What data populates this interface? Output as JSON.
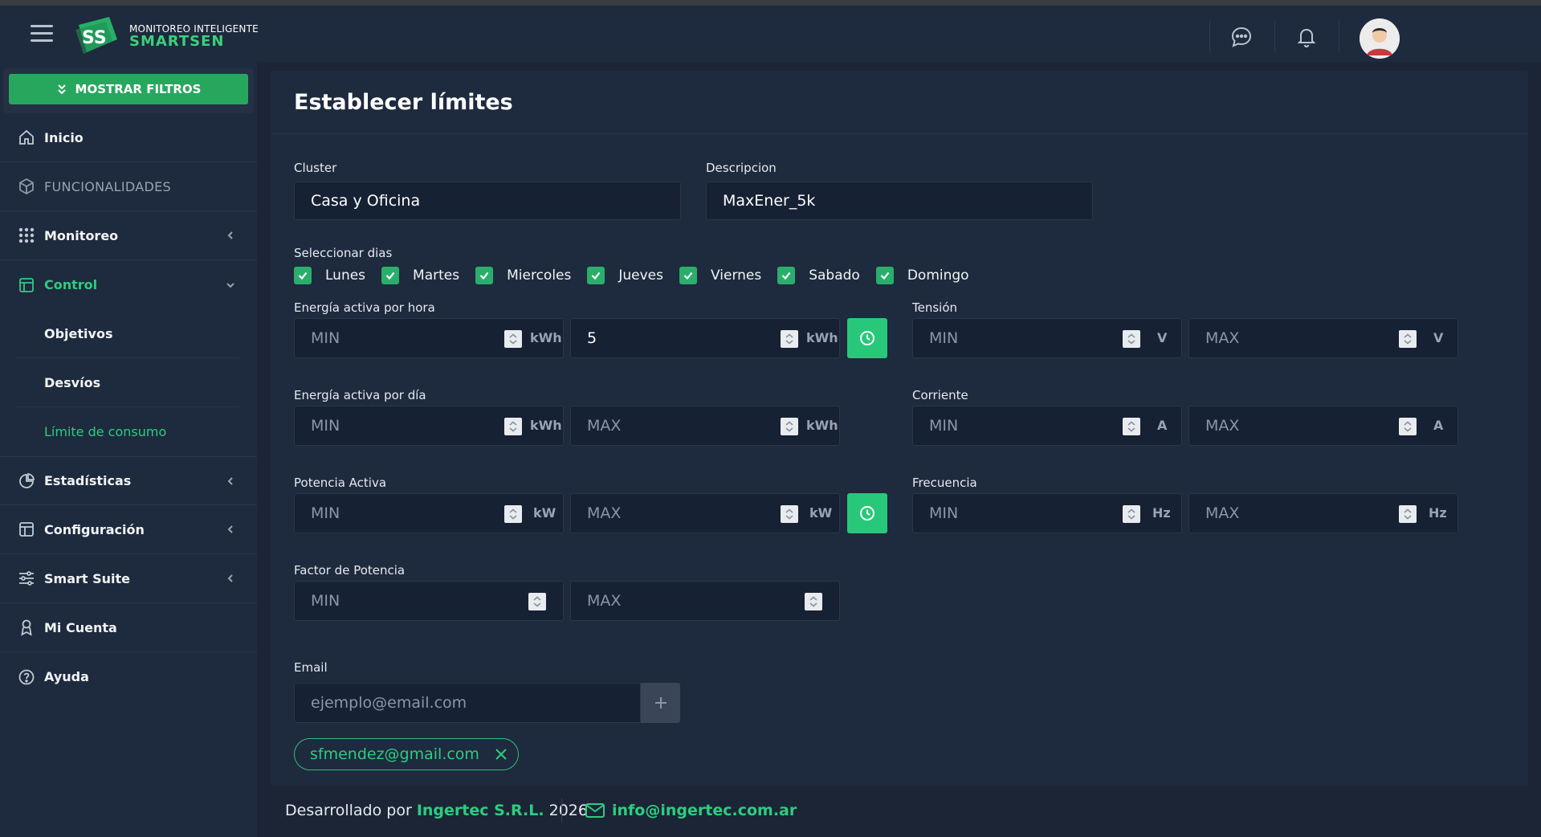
{
  "brand": {
    "subtitle": "MONITOREO INTELIGENTE",
    "name": "SMARTSEN",
    "badge": "SS"
  },
  "sidebar": {
    "filter_button": "MOSTRAR FILTROS",
    "items": [
      {
        "label": "Inicio",
        "icon": "home-icon"
      },
      {
        "label": "FUNCIONALIDADES",
        "icon": "cube-icon"
      },
      {
        "label": "Monitoreo",
        "icon": "grid-icon"
      },
      {
        "label": "Control",
        "icon": "table-icon"
      },
      {
        "label": "Estadísticas",
        "icon": "pie-icon"
      },
      {
        "label": "Configuración",
        "icon": "layout-icon"
      },
      {
        "label": "Smart Suite",
        "icon": "sliders-icon"
      },
      {
        "label": "Mi Cuenta",
        "icon": "user-icon"
      },
      {
        "label": "Ayuda",
        "icon": "help-icon"
      }
    ],
    "control_sub": [
      "Objetivos",
      "Desvíos",
      "Límite de consumo"
    ]
  },
  "panel": {
    "title": "Establecer límites",
    "cluster_label": "Cluster",
    "cluster_value": "Casa y Oficina",
    "descripcion_label": "Descripcion",
    "descripcion_value": "MaxEner_5k",
    "dias_label": "Seleccionar dias",
    "dias": [
      "Lunes",
      "Martes",
      "Miercoles",
      "Jueves",
      "Viernes",
      "Sabado",
      "Domingo"
    ],
    "energia_hora": {
      "label": "Energía activa por hora",
      "min": "MIN",
      "max": "5",
      "unit": "kWh"
    },
    "energia_dia": {
      "label": "Energía activa por día",
      "min": "MIN",
      "max": "MAX",
      "unit": "kWh"
    },
    "potencia": {
      "label": "Potencia Activa",
      "min": "MIN",
      "max": "MAX",
      "unit": "kW"
    },
    "factor": {
      "label": "Factor de Potencia",
      "min": "MIN",
      "max": "MAX"
    },
    "tension": {
      "label": "Tensión",
      "min": "MIN",
      "max": "MAX",
      "unit": "V"
    },
    "corriente": {
      "label": "Corriente",
      "min": "MIN",
      "max": "MAX",
      "unit": "A"
    },
    "frecuencia": {
      "label": "Frecuencia",
      "min": "MIN",
      "max": "MAX",
      "unit": "Hz"
    },
    "email_label": "Email",
    "email_placeholder": "ejemplo@email.com",
    "email_chip": "sfmendez@gmail.com"
  },
  "footer": {
    "prefix": "Desarrollado por",
    "company": "Ingertec S.R.L.",
    "year": "2026",
    "email": "info@ingertec.com.ar"
  },
  "colors": {
    "accent": "#2ecc80",
    "button": "#27a75e",
    "panel": "#1e2a3d",
    "input": "#172134"
  }
}
